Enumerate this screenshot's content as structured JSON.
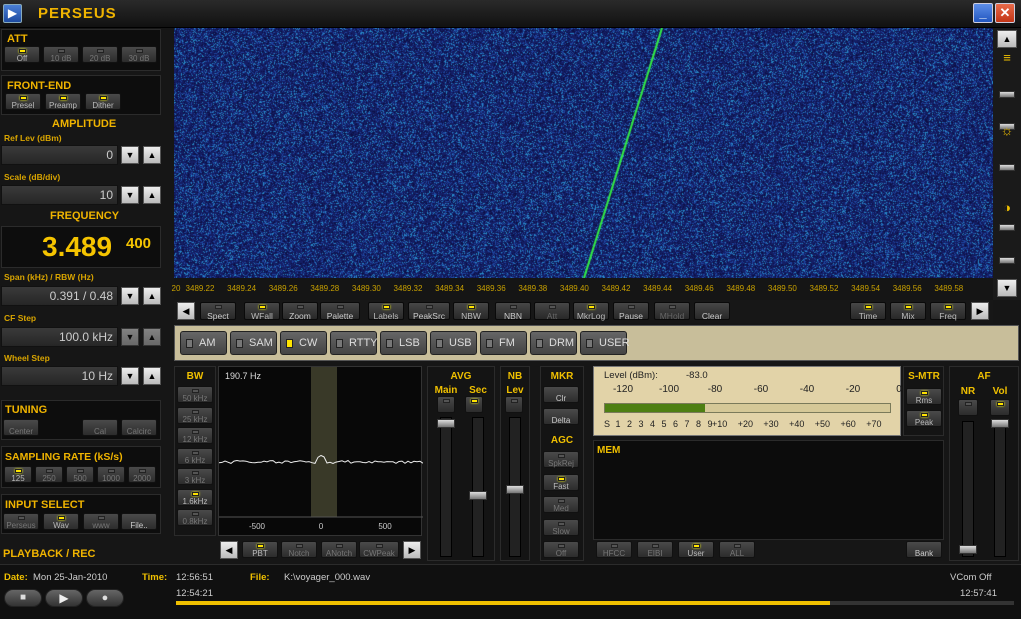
{
  "app": {
    "title": "PERSEUS",
    "icon": "app-logo-icon"
  },
  "att": {
    "title": "ATT",
    "buttons": [
      "Off",
      "10 dB",
      "20 dB",
      "30 dB"
    ],
    "active": 0
  },
  "frontend": {
    "title": "FRONT-END",
    "buttons": [
      "Presel",
      "Preamp",
      "Dither"
    ],
    "active": [
      0,
      1,
      2
    ]
  },
  "amplitude": {
    "title": "AMPLITUDE",
    "ref_label": "Ref Lev (dBm)",
    "ref_value": "0",
    "scale_label": "Scale (dB/div)",
    "scale_value": "10"
  },
  "frequency": {
    "title": "FREQUENCY",
    "main": "3.489",
    "sub": "400",
    "span_label": "Span (kHz) / RBW (Hz)",
    "span_value": "0.391 / 0.48",
    "cf_label": "CF Step",
    "cf_value": "100.0 kHz",
    "wheel_label": "Wheel Step",
    "wheel_value": "10 Hz"
  },
  "tuning": {
    "title": "TUNING",
    "buttons": [
      "Center",
      "Cal",
      "Calcirc"
    ]
  },
  "sampling": {
    "title": "SAMPLING RATE (kS/s)",
    "buttons": [
      "125",
      "250",
      "500",
      "1000",
      "2000"
    ],
    "active": 0
  },
  "input": {
    "title": "INPUT SELECT",
    "buttons": [
      "Perseus",
      "Wav",
      "www",
      "File.."
    ],
    "active": 1
  },
  "playback": {
    "title": "PLAYBACK / REC"
  },
  "freq_scale": [
    "3489.22",
    "3489.24",
    "3489.26",
    "3489.28",
    "3489.30",
    "3489.32",
    "3489.34",
    "3489.36",
    "3489.38",
    "3489.40",
    "3489.42",
    "3489.44",
    "3489.46",
    "3489.48",
    "3489.50",
    "3489.52",
    "3489.54",
    "3489.56",
    "3489.58"
  ],
  "freq_scale_left": "20",
  "toolbar": {
    "left": [
      "Spect",
      "WFall",
      "Zoom",
      "Palette",
      "Labels",
      "PeakSrc",
      "NBW",
      "NBN",
      "Att",
      "MkrLog",
      "Pause",
      "MHold",
      "Clear"
    ],
    "right": [
      "Time",
      "Mix",
      "Freq"
    ],
    "arrow_left": "◀",
    "arrow_right": "▶"
  },
  "modes": [
    "AM",
    "SAM",
    "CW",
    "RTTY",
    "LSB",
    "USB",
    "FM",
    "DRM",
    "USER"
  ],
  "active_mode": 2,
  "bw": {
    "title": "BW",
    "buttons": [
      "50 kHz",
      "25 kHz",
      "12 kHz",
      "6 kHz",
      "3 kHz",
      "1.6kHz",
      "0.8kHz"
    ],
    "active": 5
  },
  "filter": {
    "bw_value": "190.7 Hz",
    "ticks": [
      "-500",
      "0",
      "500"
    ],
    "buttons": [
      "PBT",
      "Notch",
      "ANotch",
      "CWPeak"
    ]
  },
  "avg": {
    "title": "AVG",
    "main": "Main",
    "sec": "Sec"
  },
  "nb": {
    "title": "NB",
    "lev": "Lev"
  },
  "mkr": {
    "title": "MKR",
    "buttons": [
      "Clr",
      "Delta"
    ]
  },
  "agc": {
    "title": "AGC",
    "buttons": [
      "SpkRej",
      "Fast",
      "Med",
      "Slow",
      "Off"
    ]
  },
  "meter": {
    "level_label": "Level (dBm):",
    "level_value": "-83.0",
    "dbm_ticks": [
      "-120",
      "-100",
      "-80",
      "-60",
      "-40",
      "-20",
      "0"
    ],
    "s_scale": [
      "S",
      "1",
      "2",
      "3",
      "4",
      "5",
      "6",
      "7",
      "8",
      "9",
      "+10",
      "+20",
      "+30",
      "+40",
      "+50",
      "+60",
      "+70"
    ],
    "level_fraction": 0.35
  },
  "smtr": {
    "title": "S-MTR",
    "buttons": [
      "Rms",
      "Peak"
    ]
  },
  "af": {
    "title": "AF",
    "nr": "NR",
    "vol": "Vol"
  },
  "mem": {
    "title": "MEM",
    "buttons": [
      "HFCC",
      "EIBI",
      "User",
      "ALL"
    ],
    "bank": "Bank"
  },
  "status": {
    "date_label": "Date:",
    "date": "Mon 25-Jan-2010",
    "time_label": "Time:",
    "time": "12:56:51",
    "file_label": "File:",
    "file": "K:\\voyager_000.wav",
    "vcom": "VCom Off",
    "start": "12:54:21",
    "end": "12:57:41",
    "progress": 0.78
  }
}
